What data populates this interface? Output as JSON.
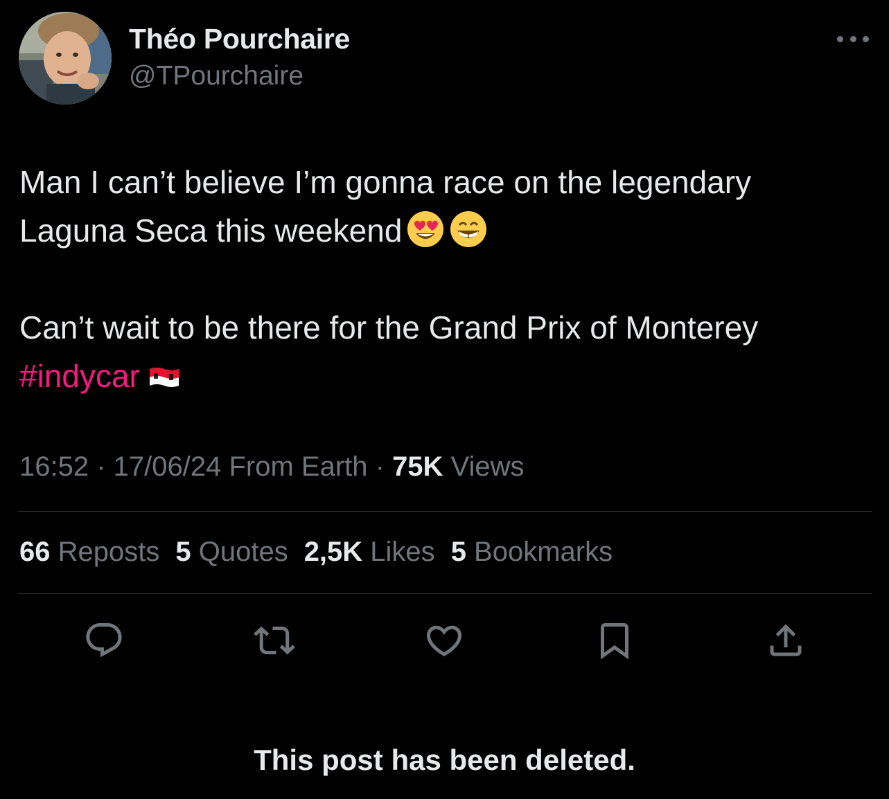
{
  "author": {
    "display_name": "Théo Pourchaire",
    "handle": "@TPourchaire",
    "avatar_icon": "profile-photo"
  },
  "more_icon": "ellipsis-icon",
  "tweet": {
    "line1": "Man I can’t believe I’m gonna race on the legendary",
    "line2": "Laguna Seca this weekend",
    "emoji1": "smiling-face-with-heart-eyes",
    "emoji2": "grinning-face-with-smiling-eyes",
    "line3": "Can’t wait to be there for the Grand Prix of Monterey",
    "hashtag": "#indycar",
    "flag_emoji": "monaco-flag"
  },
  "meta": {
    "time": "16:52",
    "sep1": " · ",
    "date": "17/06/24",
    "source": " From Earth",
    "sep2": " · ",
    "views_count": "75K",
    "views_label": " Views"
  },
  "stats": {
    "reposts_count": "66",
    "reposts_label": " Reposts",
    "quotes_count": "5",
    "quotes_label": " Quotes",
    "likes_count": "2,5K",
    "likes_label": " Likes",
    "bookmarks_count": "5",
    "bookmarks_label": " Bookmarks"
  },
  "actions": [
    "reply-icon",
    "repost-icon",
    "like-icon",
    "bookmark-icon",
    "share-icon"
  ],
  "footer": {
    "deleted_message": "This post has been deleted."
  },
  "colors": {
    "background": "#000000",
    "text": "#e7e9ea",
    "secondary_text": "#71767b",
    "hashtag": "#f91880",
    "divider": "#2f3336"
  }
}
